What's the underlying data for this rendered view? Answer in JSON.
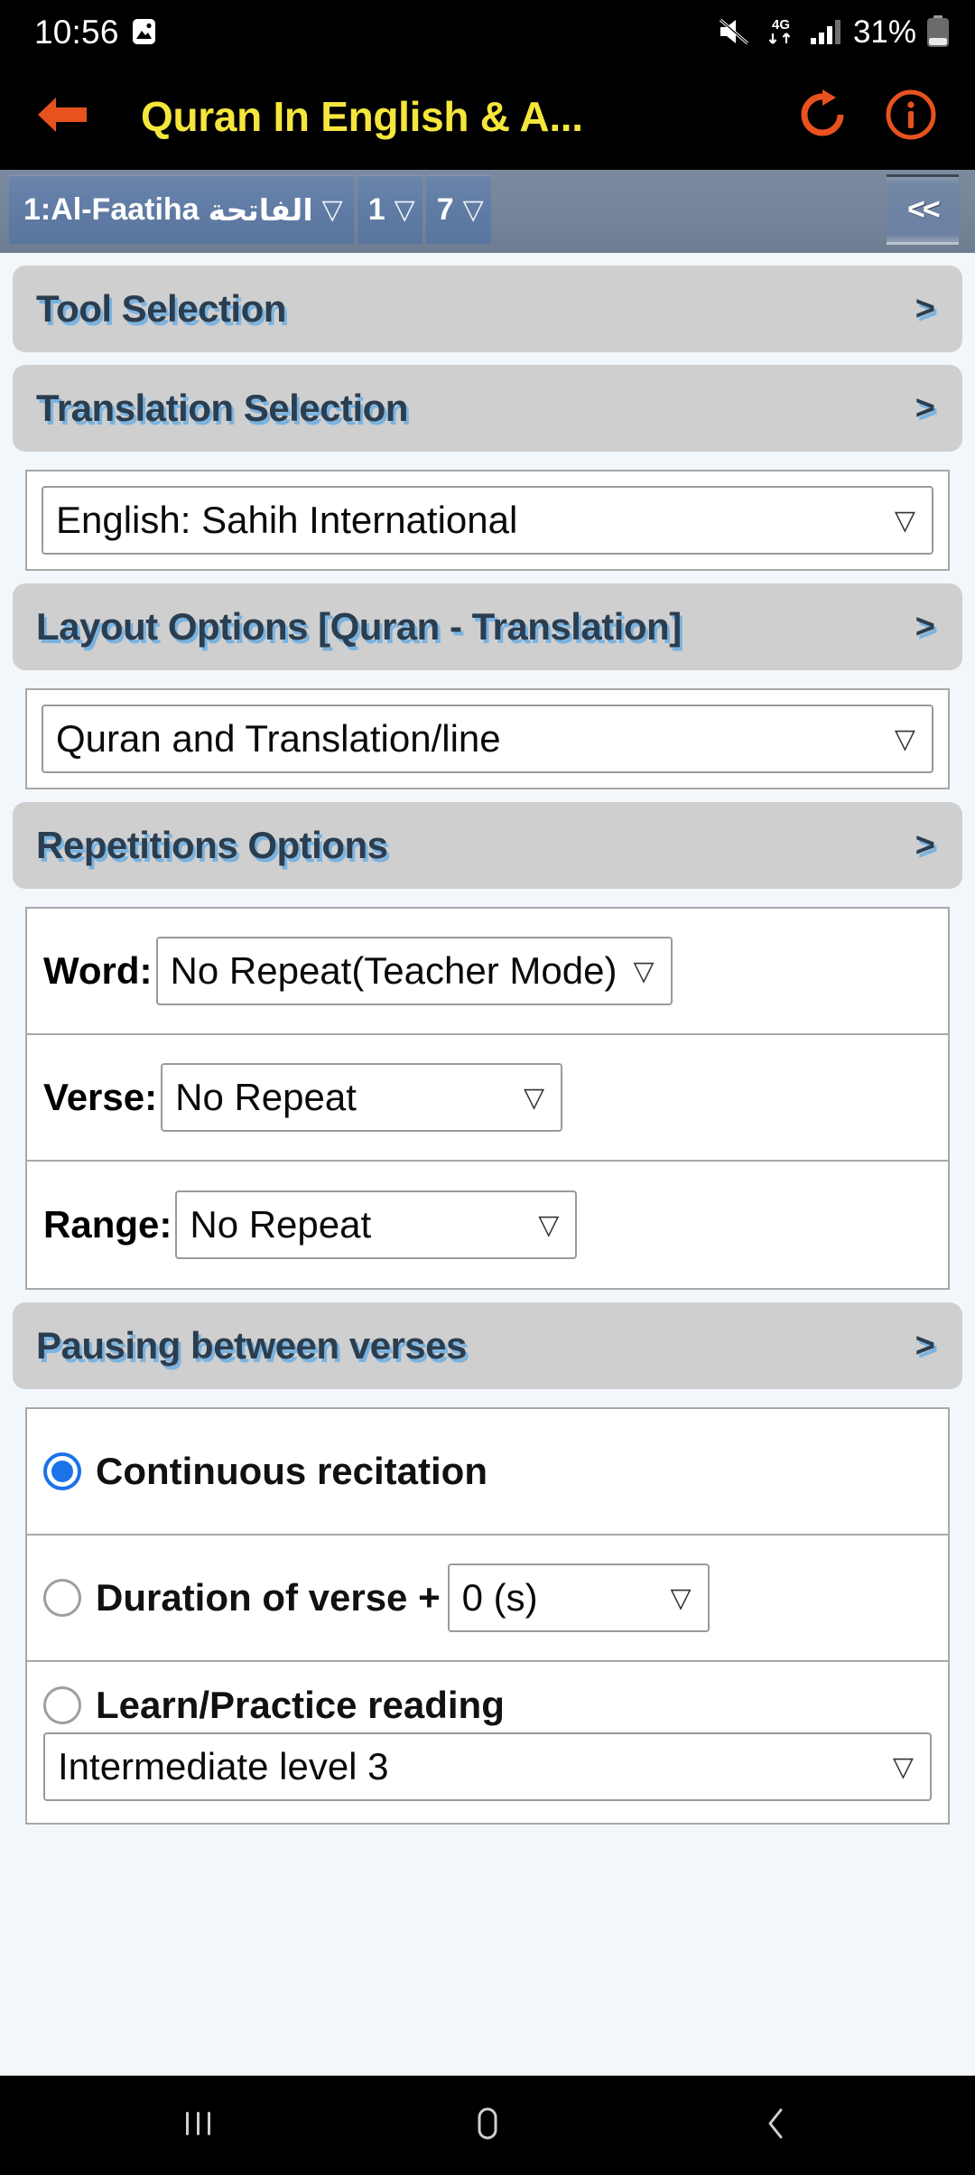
{
  "statusbar": {
    "time": "10:56",
    "photo_icon": "image-icon",
    "mute_icon": "mute-icon",
    "network_label": "4G",
    "signal_icon": "signal-bars-icon",
    "battery_percent": "31%",
    "battery_icon": "battery-icon"
  },
  "toolbar": {
    "back_icon": "back-arrow-icon",
    "title": "Quran In English & A...",
    "refresh_icon": "refresh-icon",
    "info_icon": "info-icon",
    "title_color": "#f5e63c",
    "icon_color": "#e8521f"
  },
  "selector_bar": {
    "surah": "1:Al-Faatiha",
    "surah_arabic": "الفاتحة",
    "surah_chevron": "chevron-down-icon",
    "from_verse": "1",
    "to_verse": "7",
    "collapse_label": "<<",
    "bar_color": "#77869b",
    "chip_color": "#5f7ba4"
  },
  "sections": {
    "tool_selection": {
      "title": "Tool Selection",
      "arrow": ">"
    },
    "translation_selection": {
      "title": "Translation Selection",
      "arrow": ">"
    },
    "layout_options": {
      "title": "Layout Options [Quran - Translation]",
      "arrow": ">"
    },
    "repetitions_options": {
      "title": "Repetitions Options",
      "arrow": ">"
    },
    "pausing_between_verses": {
      "title": "Pausing between verses",
      "arrow": ">"
    }
  },
  "translation": {
    "selected": "English: Sahih International",
    "chevron": "chevron-down-icon"
  },
  "layout": {
    "selected": "Quran and Translation/line",
    "chevron": "chevron-down-icon"
  },
  "repetitions": {
    "word_label": "Word:",
    "word_value": "No Repeat(Teacher Mode)",
    "verse_label": "Verse:",
    "verse_value": "No Repeat",
    "range_label": "Range:",
    "range_value": "No Repeat"
  },
  "pausing": {
    "continuous_label": "Continuous recitation",
    "continuous_selected": true,
    "duration_label": "Duration of verse +",
    "duration_value": "0 (s)",
    "duration_selected": false,
    "learn_label": "Learn/Practice reading",
    "learn_selected": false,
    "learn_level": "Intermediate level 3",
    "radio_accent": "#1a73e8"
  },
  "navbar": {
    "recents_icon": "recents-icon",
    "home_icon": "home-icon",
    "back_icon": "back-chevron-icon"
  }
}
